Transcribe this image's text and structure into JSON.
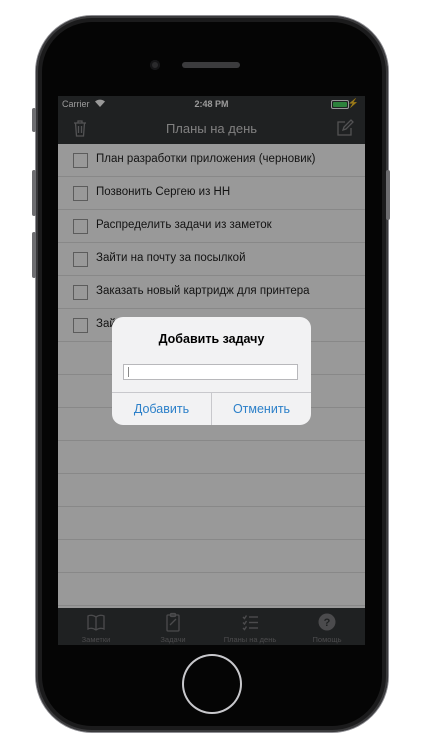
{
  "status_bar": {
    "carrier": "Carrier",
    "time": "2:48 PM"
  },
  "nav_bar": {
    "title": "Планы на день",
    "left_icon": "trash-icon",
    "right_icon": "compose-icon"
  },
  "tasks": [
    {
      "label": "План разработки приложения (черновик)",
      "checked": false
    },
    {
      "label": "Позвонить Сергею из НН",
      "checked": false
    },
    {
      "label": "Распределить задачи из заметок",
      "checked": false
    },
    {
      "label": "Зайти на почту за посылкой",
      "checked": false
    },
    {
      "label": "Заказать новый картридж для принтера",
      "checked": false
    },
    {
      "label": "Зай",
      "checked": false
    }
  ],
  "tab_bar": {
    "items": [
      {
        "label": "Заметки",
        "icon": "book-icon"
      },
      {
        "label": "Задачи",
        "icon": "clipboard-icon"
      },
      {
        "label": "Планы на день",
        "icon": "list-icon"
      },
      {
        "label": "Помощь",
        "icon": "help-icon"
      }
    ]
  },
  "alert": {
    "title": "Добавить задачу",
    "input_value": "",
    "add_label": "Добавить",
    "cancel_label": "Отменить"
  },
  "colors": {
    "bar_bg": "#353739",
    "accent": "#2c80c9",
    "battery": "#4cd964"
  }
}
